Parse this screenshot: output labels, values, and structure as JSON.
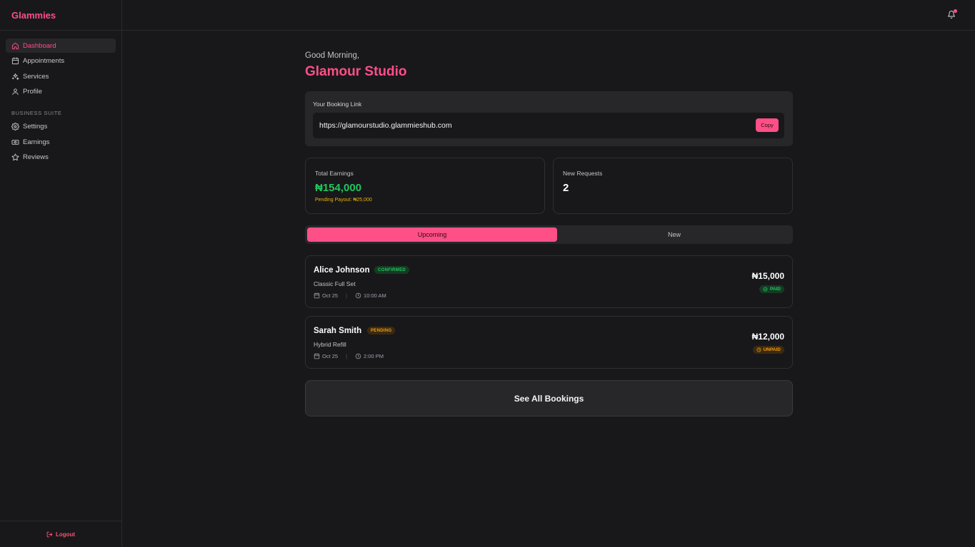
{
  "app": {
    "brand": "Glammies"
  },
  "colors": {
    "accent": "#ff4f87",
    "success": "#22c55e",
    "warning": "#f59e0b",
    "background": "#18181b",
    "surface": "#27272a"
  },
  "sidebar": {
    "items": [
      {
        "label": "Dashboard",
        "icon": "home-icon",
        "active": true
      },
      {
        "label": "Appointments",
        "icon": "calendar-icon"
      },
      {
        "label": "Services",
        "icon": "sparkles-icon"
      },
      {
        "label": "Profile",
        "icon": "user-icon"
      }
    ],
    "section_title": "BUSINESS SUITE",
    "business_items": [
      {
        "label": "Settings",
        "icon": "gear-icon"
      },
      {
        "label": "Earnings",
        "icon": "banknote-icon"
      },
      {
        "label": "Reviews",
        "icon": "star-icon"
      }
    ],
    "logout": "Logout"
  },
  "topbar": {
    "notification_icon": "bell-icon",
    "has_unread": true
  },
  "header": {
    "greeting": "Good Morning,",
    "studio_name": "Glamour Studio"
  },
  "booking_link": {
    "label": "Your Booking Link",
    "url": "https://glamourstudio.glammieshub.com",
    "copy_label": "Copy"
  },
  "stats": {
    "earnings": {
      "label": "Total Earnings",
      "value": "₦154,000",
      "sub": "Pending Payout: ₦25,000"
    },
    "requests": {
      "label": "New Requests",
      "value": "2"
    }
  },
  "tabs": [
    {
      "label": "Upcoming",
      "active": true
    },
    {
      "label": "New",
      "active": false
    }
  ],
  "bookings": [
    {
      "name": "Alice Johnson",
      "status": "CONFIRMED",
      "service": "Classic Full Set",
      "date": "Oct 25",
      "time": "10:00 AM",
      "price": "₦15,000",
      "payment": "PAID"
    },
    {
      "name": "Sarah Smith",
      "status": "PENDING",
      "service": "Hybrid Refill",
      "date": "Oct 25",
      "time": "2:00 PM",
      "price": "₦12,000",
      "payment": "UNPAID"
    }
  ],
  "see_all_label": "See All Bookings"
}
